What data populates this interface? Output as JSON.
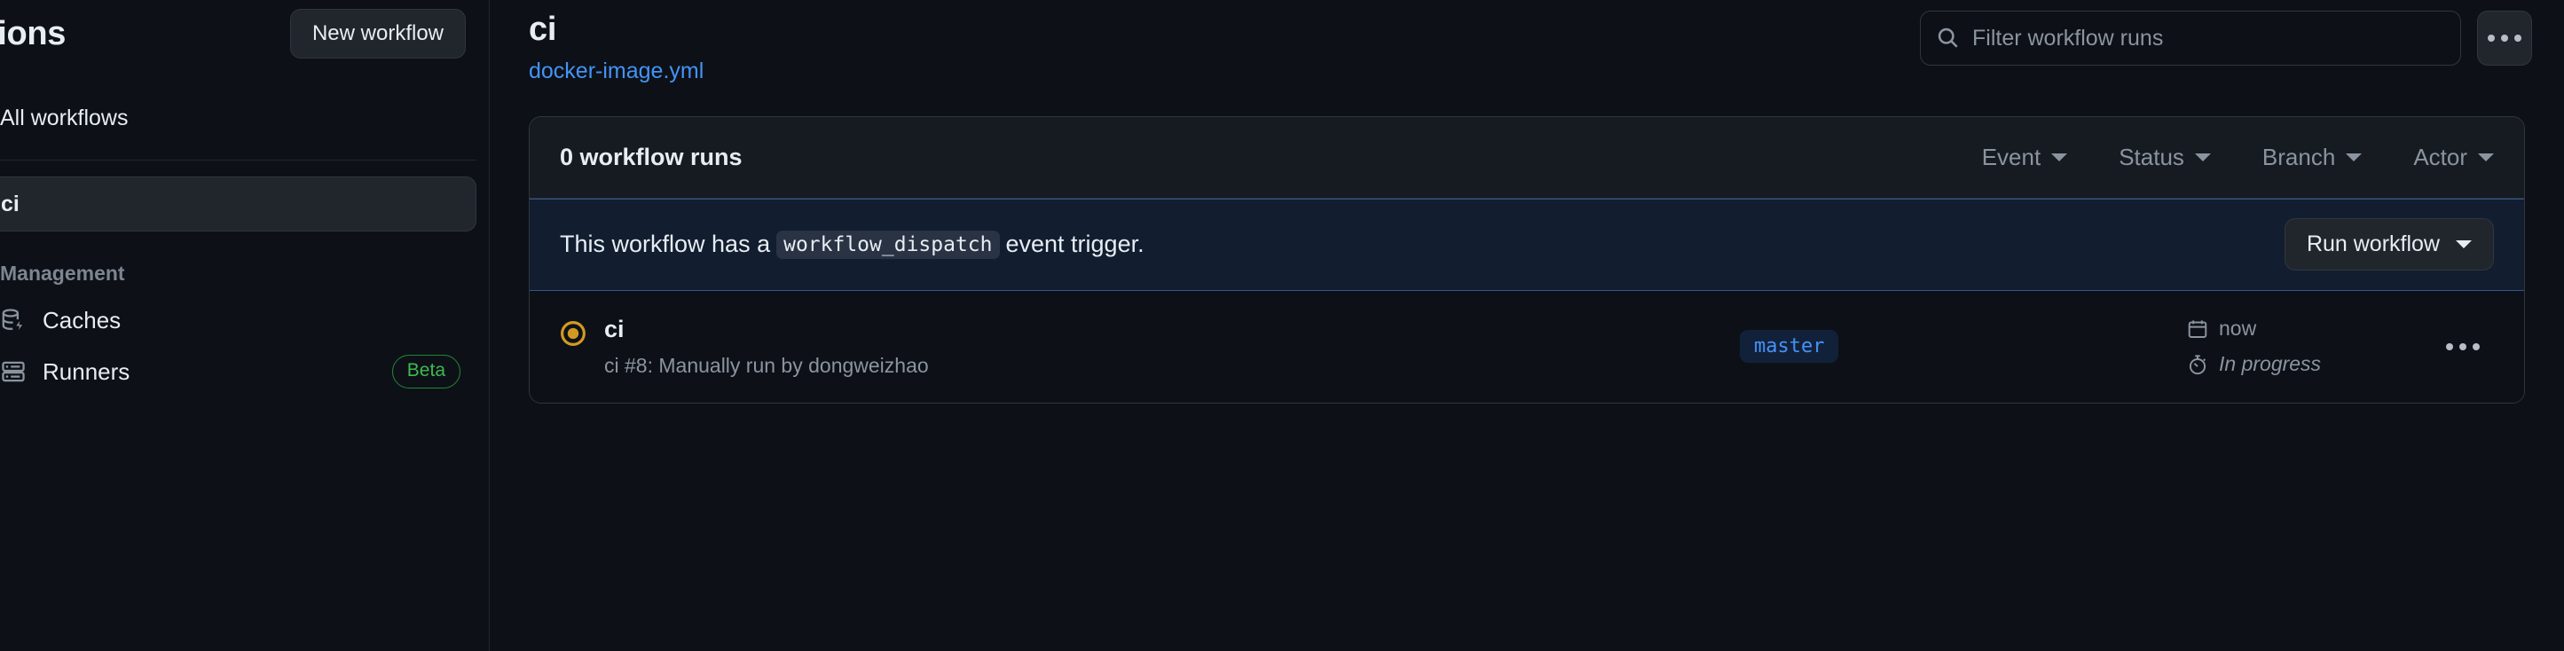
{
  "sidebar": {
    "title": "ctions",
    "new_workflow_label": "New workflow",
    "all_workflows_label": "All workflows",
    "workflow_item_label": "ci",
    "management_label": "Management",
    "management_items": [
      {
        "label": "Caches",
        "icon": "cache-icon",
        "badge": ""
      },
      {
        "label": "Runners",
        "icon": "server-icon",
        "badge": "Beta"
      }
    ]
  },
  "header": {
    "workflow_title": "ci",
    "workflow_file": "docker-image.yml",
    "search_placeholder": "Filter workflow runs",
    "search_value": "",
    "search_icon": "search-icon",
    "kebab_icon": "kebab-horizontal-icon"
  },
  "runs_card": {
    "runs_count_label": "0 workflow runs",
    "filters": [
      {
        "label": "Event"
      },
      {
        "label": "Status"
      },
      {
        "label": "Branch"
      },
      {
        "label": "Actor"
      }
    ],
    "dispatch_banner": {
      "text_before": "This workflow has a",
      "code": "workflow_dispatch",
      "text_after": "event trigger.",
      "run_button_label": "Run workflow"
    },
    "rows": [
      {
        "status_icon": "in-progress-icon",
        "name": "ci",
        "subtitle": "ci #8: Manually run by dongweizhao",
        "branch": "master",
        "time_icon": "calendar-icon",
        "time": "now",
        "duration_icon": "stopwatch-icon",
        "duration": "In progress",
        "kebab_icon": "kebab-horizontal-icon"
      }
    ]
  },
  "colors": {
    "background": "#0d1117",
    "border": "#30363d",
    "link": "#4493f8",
    "muted": "#8b949e",
    "in_progress": "#d29922",
    "beta_green": "#3fb950",
    "banner_bg": "#121d2f",
    "banner_border": "#2f5591"
  }
}
